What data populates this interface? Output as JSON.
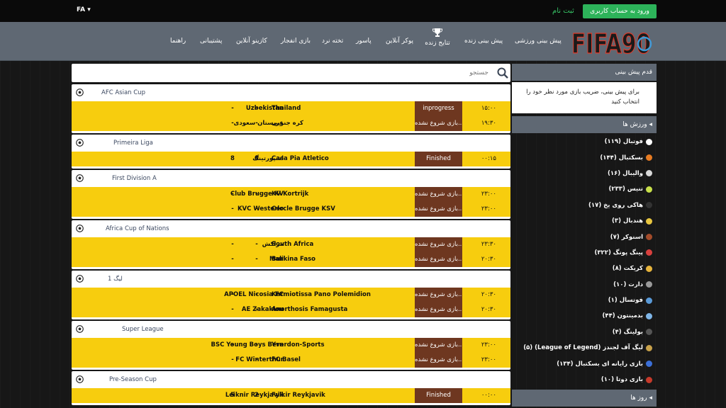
{
  "topbar": {
    "lang": "FA",
    "register": "ثبت نام",
    "login": "ورود به حساب کاربری"
  },
  "nav": {
    "items": [
      "پیش بینی ورزشی",
      "پیش بینی زنده",
      "تتایج زنده",
      "پوکر آنلاین",
      "پاسور",
      "تخته نرد",
      "بازی انفجار",
      "کازینو آنلاین",
      "پشتیبانی",
      "راهنما"
    ],
    "logo_text": "FIFA90"
  },
  "search": {
    "placeholder": "جستجو"
  },
  "sidebar": {
    "bet_header": "قدم پیش بینی",
    "bet_note": "برای پیش بینی، ضریب بازی مورد نظر خود را انتخاب کنید",
    "sports_header": "ورزش ها",
    "days_header": "روز ها",
    "sports": [
      {
        "label": "فوتبال (۱۱۹)",
        "color": "#ffffff"
      },
      {
        "label": "بسکتبال (۱۴۴)",
        "color": "#e77b22"
      },
      {
        "label": "والیبال (۱۶)",
        "color": "#d9d9d9"
      },
      {
        "label": "تنیس (۲۳۳)",
        "color": "#c8e04a"
      },
      {
        "label": "هاکی روی یخ (۱۷)",
        "color": "#333333"
      },
      {
        "label": "هندبال (۳)",
        "color": "#e8c640"
      },
      {
        "label": "اسنوکر (۷)",
        "color": "#a34b2a"
      },
      {
        "label": "پینگ پونگ (۳۲۲)",
        "color": "#d8403e"
      },
      {
        "label": "کریکت (۸)",
        "color": "#e6b43c"
      },
      {
        "label": "دارت (۱۰)",
        "color": "#9a9a9a"
      },
      {
        "label": "فوتسال (۱)",
        "color": "#5a9ad8"
      },
      {
        "label": "بدمینتون (۴۴)",
        "color": "#7fb6e8"
      },
      {
        "label": "بولینگ (۴)",
        "color": "#555555"
      },
      {
        "label": "لیگ آف لجندز (League of Legend) (۵)",
        "color": "#c8a14a"
      },
      {
        "label": "بازی رایانه ای بسکتبال (۱۳۴)",
        "color": "#3b6fd8"
      },
      {
        "label": "بازی دوتا (۱۰)",
        "color": "#c63a2b"
      }
    ]
  },
  "leagues": [
    {
      "name": "AFC Asian Cup",
      "matches": [
        {
          "home": "Uzbekistan",
          "sh": "-",
          "sa": "-",
          "away": "Thailand",
          "status": "inprogress",
          "time": "۱۵:۰۰"
        },
        {
          "home": "عربستان سعودی",
          "sh": "-",
          "sa": "-",
          "away": "کره جنوبی",
          "status": "بازی شروع نشده...",
          "time": "۱۹:۳۰"
        }
      ]
    },
    {
      "name": "Primeira Liga",
      "matches": [
        {
          "home": "اسپورتینگ",
          "sh": "8",
          "sa": "0",
          "away": "Casa Pia Atletico",
          "status": "Finished",
          "time": "۰۰:۱۵"
        }
      ]
    },
    {
      "name": "First Division A",
      "matches": [
        {
          "home": "Club Brugge KV",
          "sh": "-",
          "sa": "-",
          "away": "KV Kortrijk",
          "status": "بازی شروع نشده...",
          "time": "۲۳:۰۰"
        },
        {
          "home": "KVC Westerlo",
          "sh": "-",
          "sa": "-",
          "away": "Cercle Brugge KSV",
          "status": "بازی شروع نشده...",
          "time": "۲۳:۰۰"
        }
      ]
    },
    {
      "name": "Africa Cup of Nations",
      "matches": [
        {
          "home": "مراکش",
          "sh": "-",
          "sa": "-",
          "away": "South Africa",
          "status": "بازی شروع نشده...",
          "time": "۲۳:۳۰"
        },
        {
          "home": "Mali",
          "sh": "-",
          "sa": "-",
          "away": "Burkina Faso",
          "status": "بازی شروع نشده...",
          "time": "۲۰:۳۰"
        }
      ]
    },
    {
      "name": "لیگ 1",
      "matches": [
        {
          "home": "APOEL Nicosia FC",
          "sh": "-",
          "sa": "-",
          "away": "Karmiotissa Pano Polemidion",
          "status": "بازی شروع نشده...",
          "time": "۲۰:۳۰"
        },
        {
          "home": "AE Zakakiou",
          "sh": "-",
          "sa": "-",
          "away": "Anorthosis Famagusta",
          "status": "بازی شروع نشده...",
          "time": "۲۰:۳۰"
        }
      ]
    },
    {
      "name": "Super League",
      "matches": [
        {
          "home": "BSC Young Boys Bern",
          "sh": "-",
          "sa": "-",
          "away": "Yverdon-Sports",
          "status": "بازی شروع نشده...",
          "time": "۲۳:۰۰"
        },
        {
          "home": "FC Winterthur",
          "sh": "-",
          "sa": "-",
          "away": "FC Basel",
          "status": "بازی شروع نشده...",
          "time": "۲۳:۰۰"
        }
      ]
    },
    {
      "name": "Pre-Season Cup",
      "matches": [
        {
          "home": "Leiknir Reykjavik",
          "sh": "5",
          "sa": "2",
          "away": "Fylkir Reykjavik",
          "status": "Finished",
          "time": "۰۰:۰۰"
        }
      ]
    }
  ]
}
